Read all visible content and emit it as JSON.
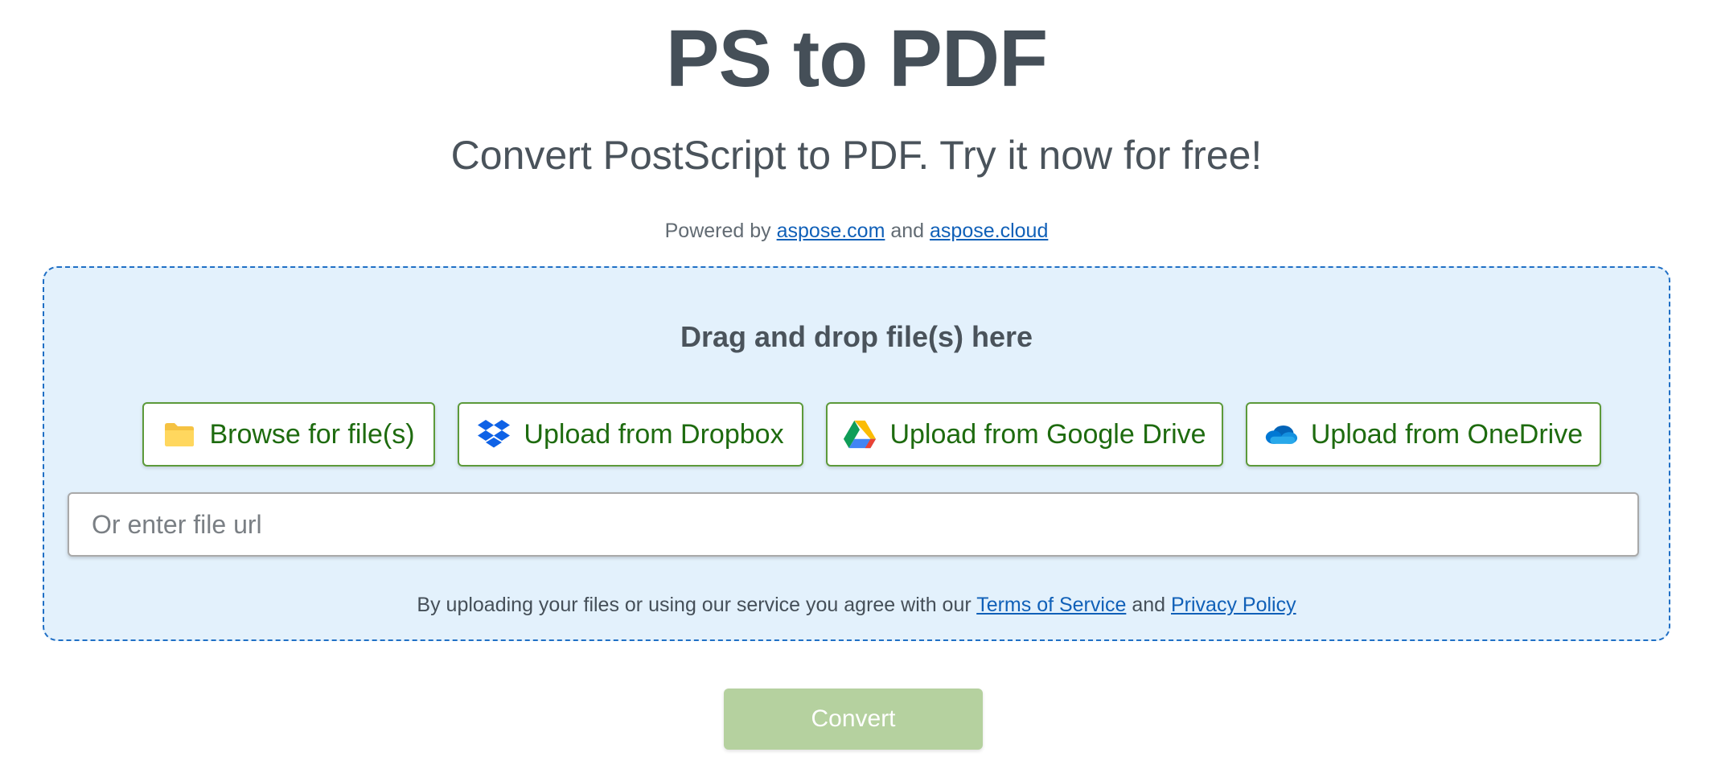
{
  "header": {
    "title": "PS to PDF",
    "subtitle": "Convert PostScript to PDF. Try it now for free!",
    "powered_prefix": "Powered by",
    "powered_link1": "aspose.com",
    "powered_and": "and",
    "powered_link2": "aspose.cloud"
  },
  "dropzone": {
    "drag_text": "Drag and drop file(s) here",
    "buttons": [
      {
        "label": "Browse for file(s)",
        "icon": "folder-icon"
      },
      {
        "label": "Upload from Dropbox",
        "icon": "dropbox-icon"
      },
      {
        "label": "Upload from Google Drive",
        "icon": "google-drive-icon"
      },
      {
        "label": "Upload from OneDrive",
        "icon": "onedrive-icon"
      }
    ],
    "url_placeholder": "Or enter file url",
    "terms_prefix": "By uploading your files or using our service you agree with our",
    "terms_link": "Terms of Service",
    "terms_and": "and",
    "privacy_link": "Privacy Policy"
  },
  "convert": {
    "label": "Convert"
  },
  "colors": {
    "accent_green": "#1e6b0f",
    "button_border": "#5c9a3a",
    "dropzone_bg": "#e3f1fc",
    "dropzone_border": "#1f6fc5",
    "link": "#1060b8",
    "convert_disabled": "#b5d19f"
  }
}
